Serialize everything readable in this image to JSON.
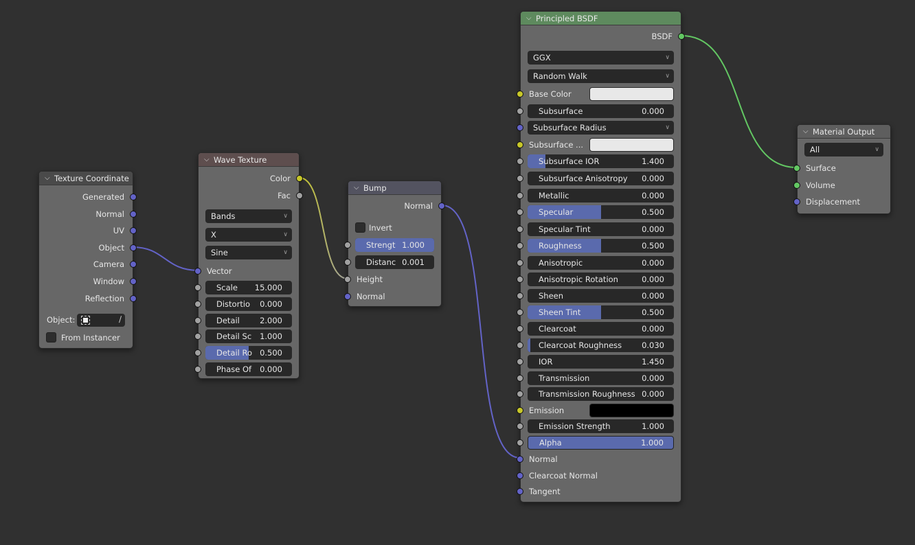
{
  "colors": {
    "background": "#303030",
    "node_body": "#676767",
    "header_texcoord": "#4a4a4a",
    "header_wave": "#5e4e4e",
    "header_bump": "#535360",
    "header_bsdf": "#5e8a5e",
    "header_output": "#5e5e5e",
    "socket_vector": "#6363c7",
    "socket_color": "#c7c729",
    "socket_float": "#a1a1a1",
    "socket_shader": "#63c763",
    "slider_fill": "#5a6aad"
  },
  "nodes": {
    "texcoord": {
      "title": "Texture Coordinate",
      "outputs": [
        "Generated",
        "Normal",
        "UV",
        "Object",
        "Camera",
        "Window",
        "Reflection"
      ],
      "object_label": "Object:",
      "from_instancer_label": "From Instancer",
      "from_instancer_checked": false
    },
    "wave": {
      "title": "Wave Texture",
      "outputs": [
        "Color",
        "Fac"
      ],
      "dropdowns": [
        "Bands",
        "X",
        "Sine"
      ],
      "vector_label": "Vector",
      "fields": [
        {
          "label": "Scale",
          "value": "15.000",
          "fill": 0
        },
        {
          "label": "Distortio",
          "value": "0.000",
          "fill": 0
        },
        {
          "label": "Detail",
          "value": "2.000",
          "fill": 0
        },
        {
          "label": "Detail Sc",
          "value": "1.000",
          "fill": 0
        },
        {
          "label": "Detail Ro",
          "value": "0.500",
          "fill": 0.5
        },
        {
          "label": "Phase Of",
          "value": "0.000",
          "fill": 0
        }
      ]
    },
    "bump": {
      "title": "Bump",
      "output": "Normal",
      "invert_label": "Invert",
      "invert_checked": false,
      "fields": [
        {
          "label": "Strengt",
          "value": "1.000",
          "fill": 1.0
        },
        {
          "label": "Distanc",
          "value": "0.001",
          "fill": 0
        }
      ],
      "inputs": [
        "Height",
        "Normal"
      ]
    },
    "bsdf": {
      "title": "Principled BSDF",
      "output": "BSDF",
      "distribution": "GGX",
      "subsurface_method": "Random Walk",
      "base_color_label": "Base Color",
      "base_color": "#e8e8e8",
      "subsurface_label": "Subsurface",
      "subsurface_value": "0.000",
      "subsurface_radius_label": "Subsurface Radius",
      "subsurface_color_label": "Subsurface ...",
      "subsurface_color": "#e8e8e8",
      "fields": [
        {
          "label": "Subsurface IOR",
          "value": "1.400",
          "fill": 0.12
        },
        {
          "label": "Subsurface Anisotropy",
          "value": "0.000",
          "fill": 0
        },
        {
          "label": "Metallic",
          "value": "0.000",
          "fill": 0
        },
        {
          "label": "Specular",
          "value": "0.500",
          "fill": 0.5
        },
        {
          "label": "Specular Tint",
          "value": "0.000",
          "fill": 0
        },
        {
          "label": "Roughness",
          "value": "0.500",
          "fill": 0.5
        },
        {
          "label": "Anisotropic",
          "value": "0.000",
          "fill": 0
        },
        {
          "label": "Anisotropic Rotation",
          "value": "0.000",
          "fill": 0
        },
        {
          "label": "Sheen",
          "value": "0.000",
          "fill": 0
        },
        {
          "label": "Sheen Tint",
          "value": "0.500",
          "fill": 0.5
        },
        {
          "label": "Clearcoat",
          "value": "0.000",
          "fill": 0
        },
        {
          "label": "Clearcoat Roughness",
          "value": "0.030",
          "fill": 0.03
        },
        {
          "label": "IOR",
          "value": "1.450",
          "fill": 0
        },
        {
          "label": "Transmission",
          "value": "0.000",
          "fill": 0
        },
        {
          "label": "Transmission Roughness",
          "value": "0.000",
          "fill": 0
        }
      ],
      "emission_label": "Emission",
      "emission_color": "#000000",
      "emission_strength_label": "Emission Strength",
      "emission_strength_value": "1.000",
      "alpha_label": "Alpha",
      "alpha_value": "1.000",
      "alpha_fill": 1.0,
      "vector_inputs": [
        "Normal",
        "Clearcoat Normal",
        "Tangent"
      ]
    },
    "output": {
      "title": "Material Output",
      "target": "All",
      "inputs": [
        "Surface",
        "Volume",
        "Displacement"
      ]
    }
  }
}
